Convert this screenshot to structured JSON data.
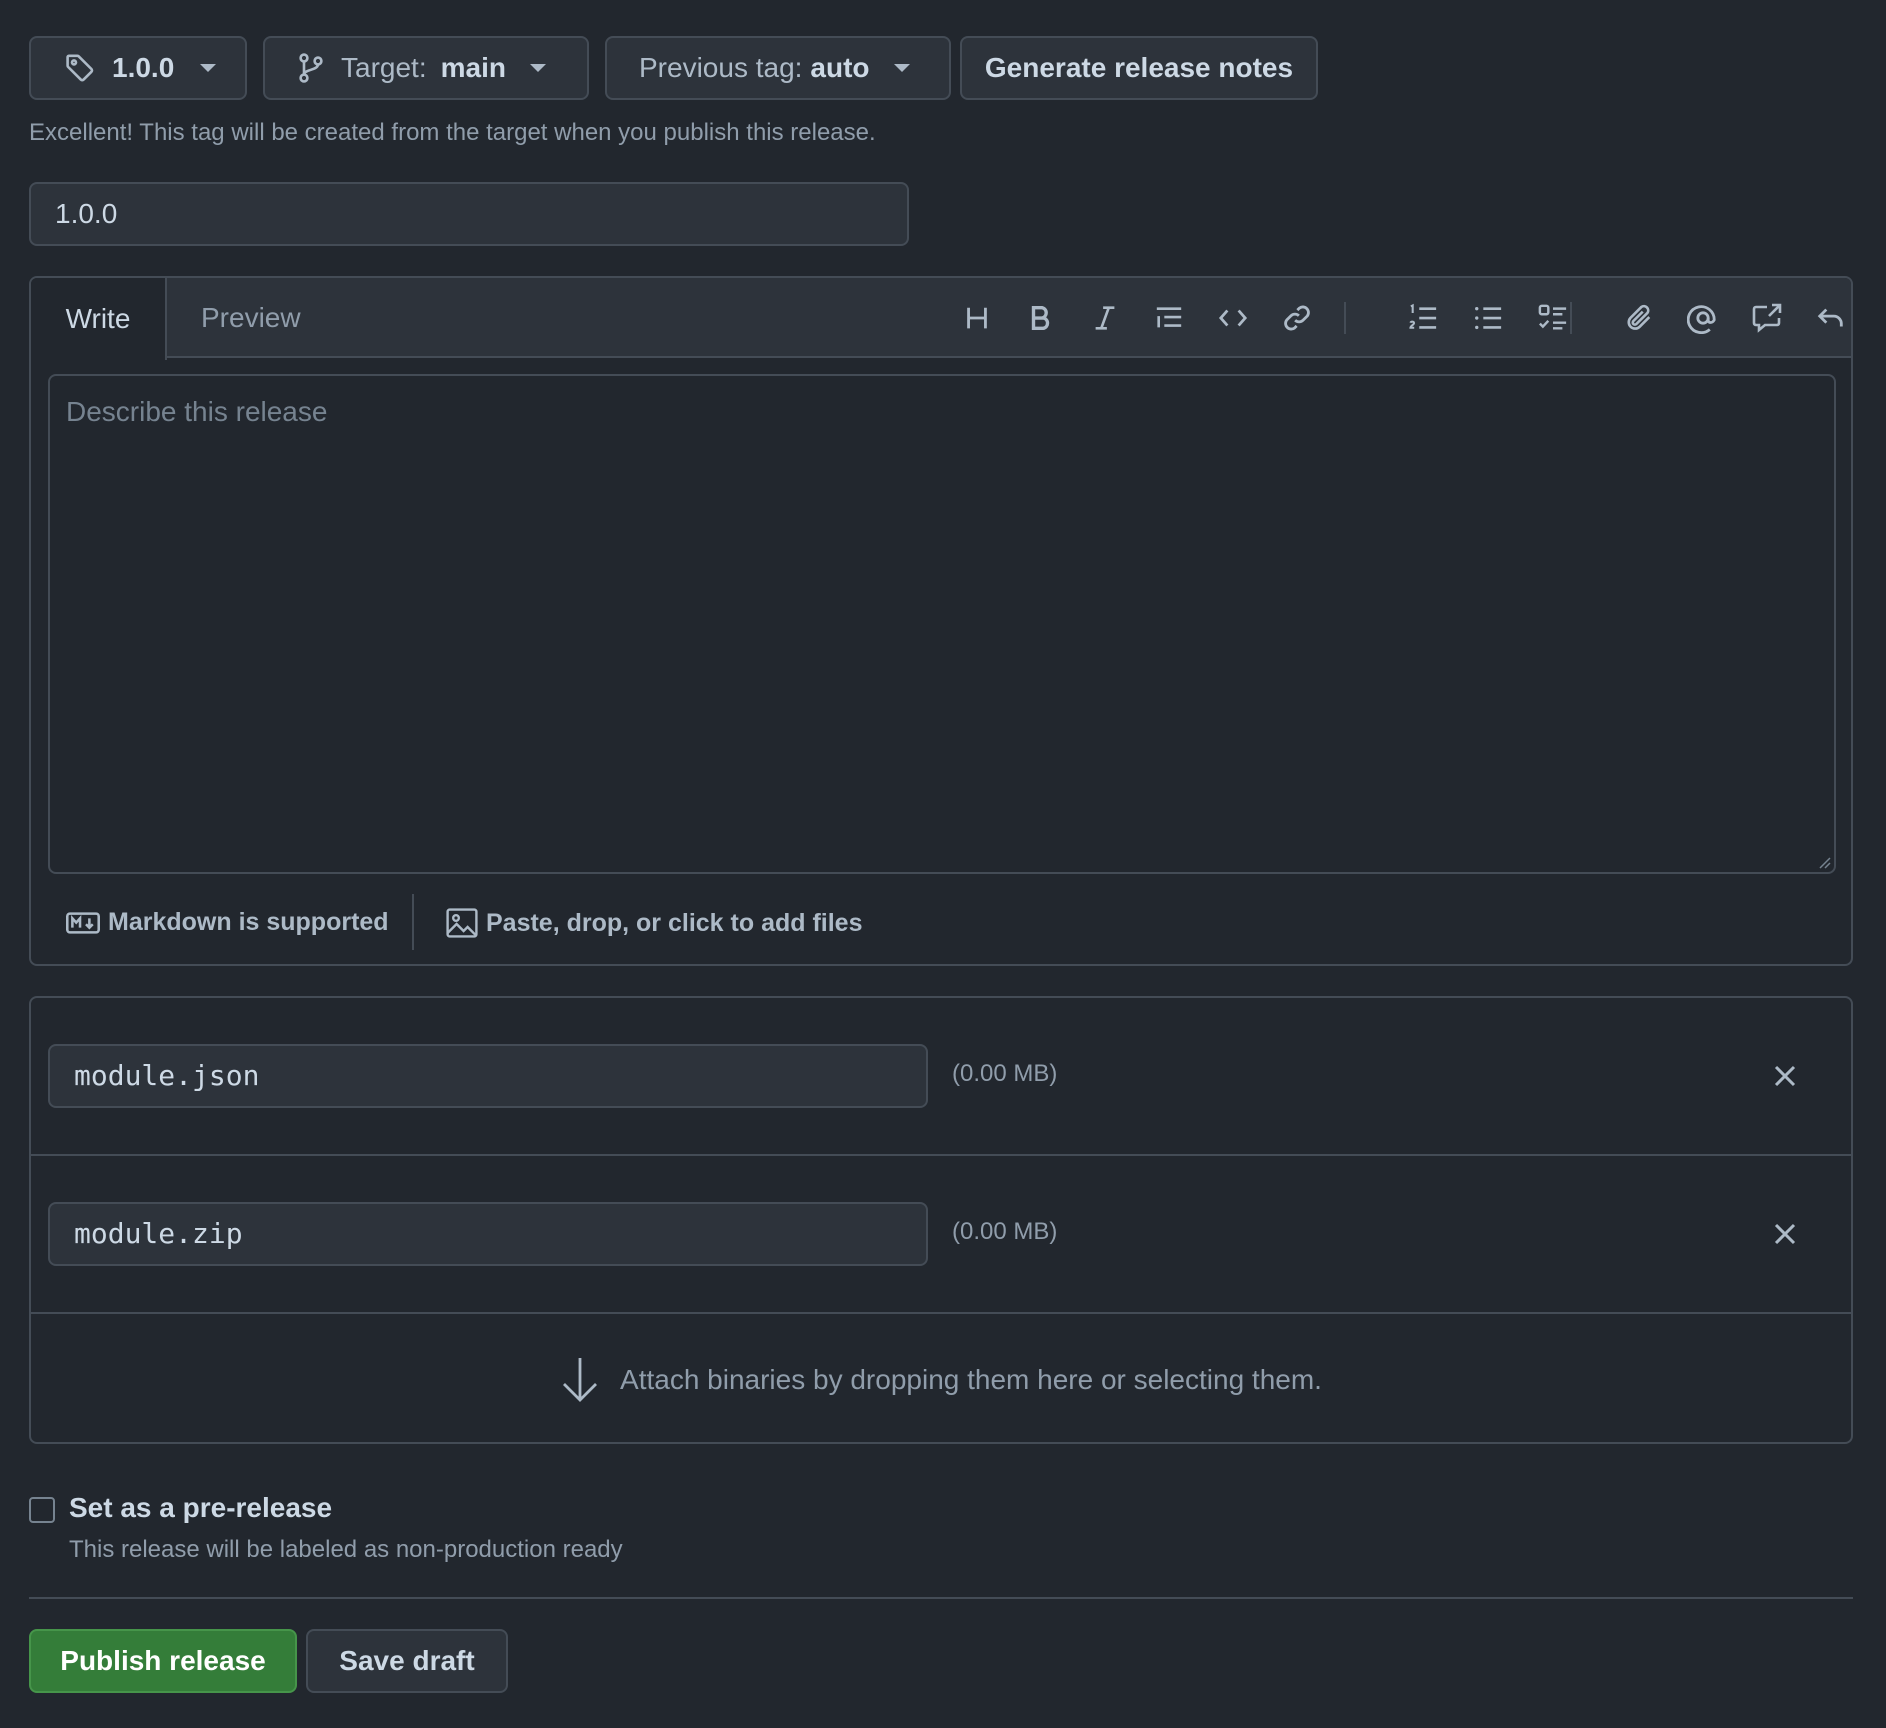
{
  "tag_selector": {
    "label": "1.0.0",
    "icon": "tag-icon"
  },
  "target_selector": {
    "prefix": "Target:",
    "value": "main",
    "icon": "git-branch-icon"
  },
  "previous_tag_selector": {
    "prefix": "Previous tag:",
    "value": "auto"
  },
  "generate_button": {
    "label": "Generate release notes"
  },
  "tag_hint": "Excellent! This tag will be created from the target when you publish this release.",
  "release_title": {
    "value": "1.0.0"
  },
  "editor": {
    "tabs": [
      {
        "label": "Write"
      },
      {
        "label": "Preview"
      }
    ],
    "placeholder": "Describe this release",
    "toolbar_icons": [
      "heading-icon",
      "bold-icon",
      "italic-icon",
      "quote-icon",
      "code-icon",
      "link-icon",
      "ordered-list-icon",
      "unordered-list-icon",
      "task-list-icon",
      "attach-icon",
      "mention-icon",
      "reference-icon",
      "undo-icon"
    ],
    "markdown_note": "Markdown is supported",
    "attach_note": "Paste, drop, or click to add files"
  },
  "assets": {
    "files": [
      {
        "name": "module.json",
        "size": "(0.00 MB)"
      },
      {
        "name": "module.zip",
        "size": "(0.00 MB)"
      }
    ],
    "dropzone_text": "Attach binaries by dropping them here or selecting them."
  },
  "prerelease": {
    "label": "Set as a pre-release",
    "description": "This release will be labeled as non-production ready",
    "checked": false
  },
  "actions": {
    "publish": "Publish release",
    "save_draft": "Save draft"
  },
  "colors": {
    "background": "#22272e",
    "surface": "#2d333b",
    "border": "#444c56",
    "primary_button": "#347d39"
  }
}
